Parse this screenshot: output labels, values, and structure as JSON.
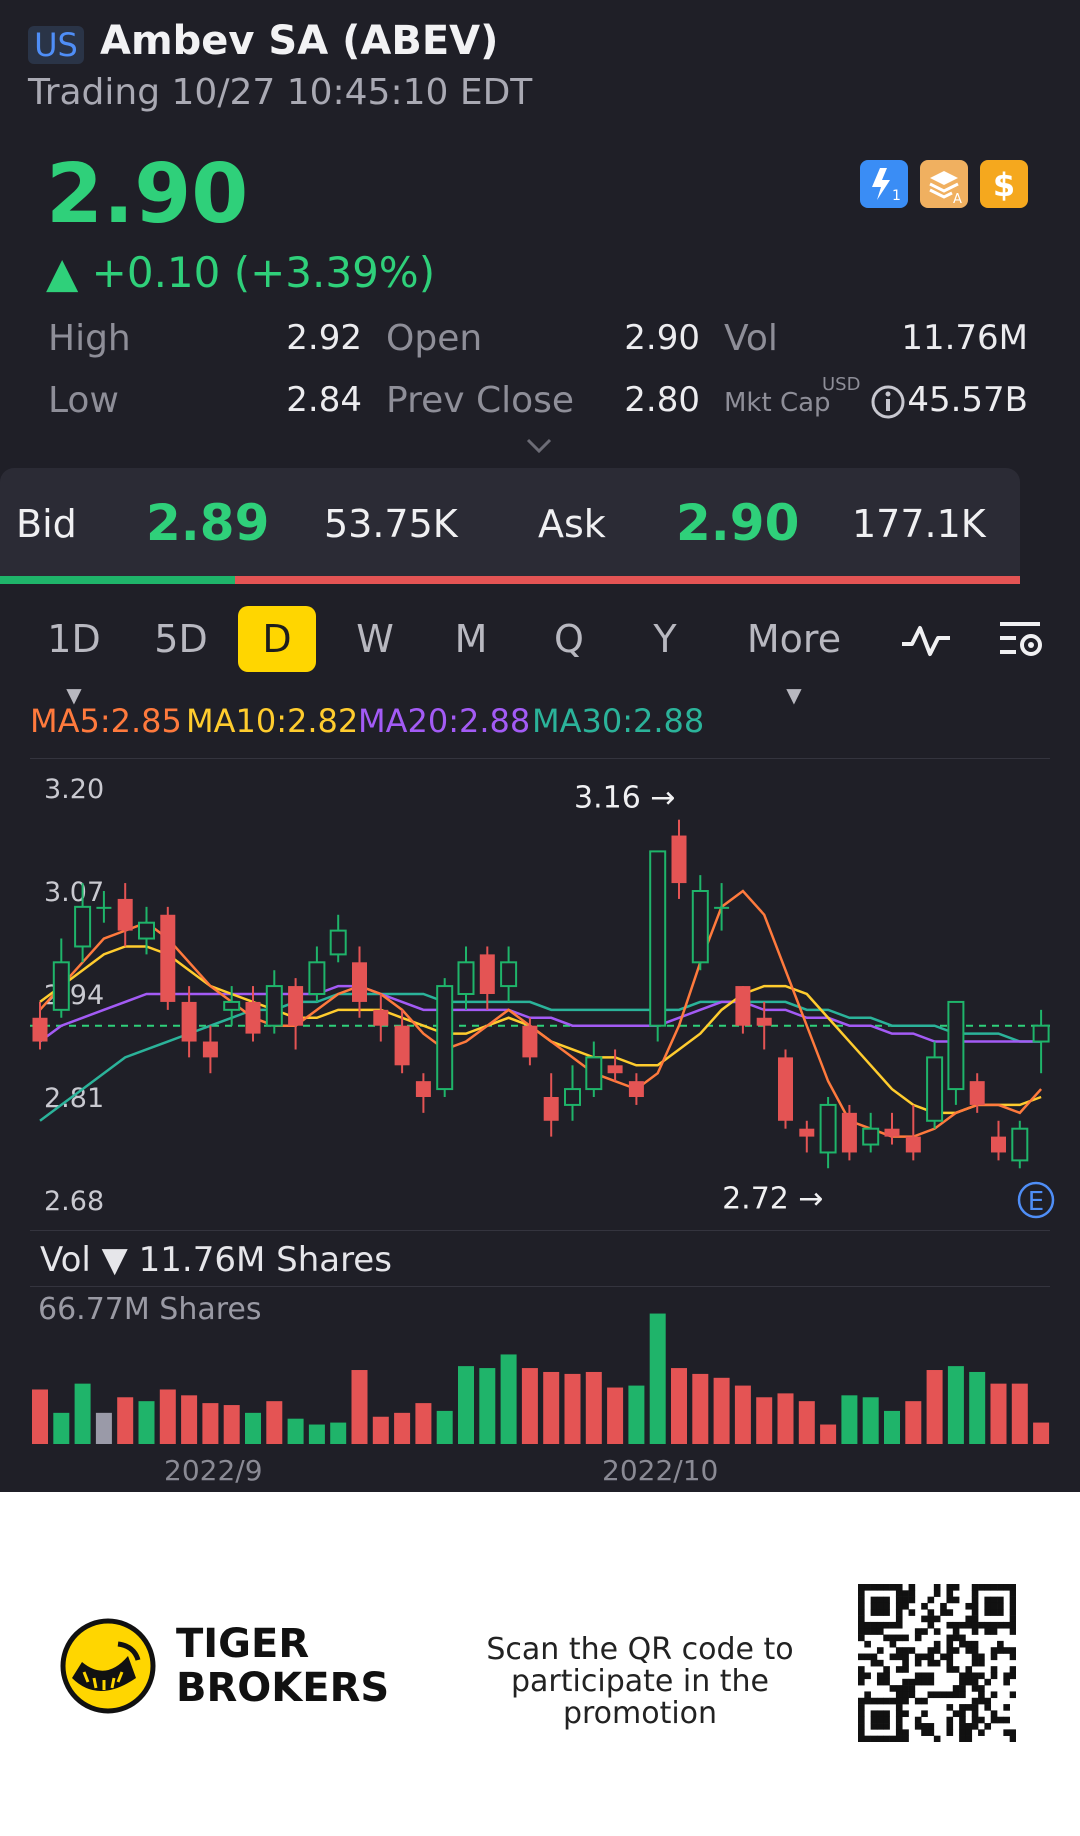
{
  "header": {
    "market": "US",
    "title": "Ambev SA (ABEV)",
    "status": "Trading 10/27 10:45:10 EDT",
    "price": "2.90",
    "change": "▲ +0.10 (+3.39%)",
    "icons": [
      "lightning-level1-icon",
      "level-a-stack-icon",
      "dollar-icon"
    ]
  },
  "stats": {
    "high_label": "High",
    "high": "2.92",
    "open_label": "Open",
    "open": "2.90",
    "vol_label": "Vol",
    "vol": "11.76M",
    "low_label": "Low",
    "low": "2.84",
    "prev_close_label": "Prev Close",
    "prev_close": "2.80",
    "mkt_cap_label": "Mkt Cap",
    "mkt_cap_currency": "USD",
    "mkt_cap": "45.57B"
  },
  "bidask": {
    "bid_label": "Bid",
    "bid_price": "2.89",
    "bid_size": "53.75K",
    "ask_label": "Ask",
    "ask_price": "2.90",
    "ask_size": "177.1K",
    "bid_ratio": 0.23
  },
  "tabs": {
    "items": [
      "1D",
      "5D",
      "D",
      "W",
      "M",
      "Q",
      "Y",
      "More"
    ],
    "active": "D"
  },
  "indicators": {
    "ma5": "MA5:2.85",
    "ma10": "MA10:2.82",
    "ma20": "MA20:2.88",
    "ma30": "MA30:2.88"
  },
  "volume": {
    "title": "Vol ▼ 11.76M Shares",
    "max_label": "66.77M Shares"
  },
  "chart_data": {
    "type": "candlestick",
    "ylim": [
      2.68,
      3.2
    ],
    "y_ticks": [
      "3.20",
      "3.07",
      "2.94",
      "2.81",
      "2.68"
    ],
    "x_ticks": [
      "2022/9",
      "2022/10"
    ],
    "high_marker": "3.16 →",
    "low_marker": "2.72 →",
    "last_price_line": 2.9,
    "event_marker": "E",
    "colors": {
      "up": "#1fb46a",
      "down": "#e45454",
      "ma5": "#ff7a3d",
      "ma10": "#ffcc2e",
      "ma20": "#a35bf5",
      "ma30": "#2bb39a"
    },
    "candles": [
      {
        "o": 2.91,
        "c": 2.88,
        "h": 2.93,
        "l": 2.87
      },
      {
        "o": 2.92,
        "c": 2.98,
        "h": 3.01,
        "l": 2.91
      },
      {
        "o": 3.0,
        "c": 3.05,
        "h": 3.08,
        "l": 2.98
      },
      {
        "o": 3.05,
        "c": 3.05,
        "h": 3.07,
        "l": 3.03
      },
      {
        "o": 3.06,
        "c": 3.02,
        "h": 3.08,
        "l": 3.0
      },
      {
        "o": 3.01,
        "c": 3.03,
        "h": 3.05,
        "l": 2.99
      },
      {
        "o": 3.04,
        "c": 2.93,
        "h": 3.05,
        "l": 2.92
      },
      {
        "o": 2.93,
        "c": 2.88,
        "h": 2.95,
        "l": 2.86
      },
      {
        "o": 2.88,
        "c": 2.86,
        "h": 2.9,
        "l": 2.84
      },
      {
        "o": 2.92,
        "c": 2.93,
        "h": 2.95,
        "l": 2.9
      },
      {
        "o": 2.93,
        "c": 2.89,
        "h": 2.95,
        "l": 2.88
      },
      {
        "o": 2.9,
        "c": 2.95,
        "h": 2.97,
        "l": 2.89
      },
      {
        "o": 2.95,
        "c": 2.9,
        "h": 2.96,
        "l": 2.87
      },
      {
        "o": 2.94,
        "c": 2.98,
        "h": 3.0,
        "l": 2.93
      },
      {
        "o": 2.99,
        "c": 3.02,
        "h": 3.04,
        "l": 2.98
      },
      {
        "o": 2.98,
        "c": 2.93,
        "h": 3.0,
        "l": 2.91
      },
      {
        "o": 2.92,
        "c": 2.9,
        "h": 2.94,
        "l": 2.88
      },
      {
        "o": 2.9,
        "c": 2.85,
        "h": 2.92,
        "l": 2.84
      },
      {
        "o": 2.83,
        "c": 2.81,
        "h": 2.84,
        "l": 2.79
      },
      {
        "o": 2.82,
        "c": 2.95,
        "h": 2.96,
        "l": 2.81
      },
      {
        "o": 2.94,
        "c": 2.98,
        "h": 3.0,
        "l": 2.92
      },
      {
        "o": 2.99,
        "c": 2.94,
        "h": 3.0,
        "l": 2.92
      },
      {
        "o": 2.95,
        "c": 2.98,
        "h": 3.0,
        "l": 2.93
      },
      {
        "o": 2.9,
        "c": 2.86,
        "h": 2.91,
        "l": 2.85
      },
      {
        "o": 2.81,
        "c": 2.78,
        "h": 2.84,
        "l": 2.76
      },
      {
        "o": 2.8,
        "c": 2.82,
        "h": 2.85,
        "l": 2.78
      },
      {
        "o": 2.82,
        "c": 2.86,
        "h": 2.88,
        "l": 2.81
      },
      {
        "o": 2.85,
        "c": 2.84,
        "h": 2.87,
        "l": 2.83
      },
      {
        "o": 2.83,
        "c": 2.81,
        "h": 2.84,
        "l": 2.8
      },
      {
        "o": 2.9,
        "c": 3.12,
        "h": 3.12,
        "l": 2.88
      },
      {
        "o": 3.14,
        "c": 3.08,
        "h": 3.16,
        "l": 3.06
      },
      {
        "o": 2.98,
        "c": 3.07,
        "h": 3.09,
        "l": 2.97
      },
      {
        "o": 3.05,
        "c": 3.05,
        "h": 3.08,
        "l": 3.02
      },
      {
        "o": 2.95,
        "c": 2.9,
        "h": 2.95,
        "l": 2.89
      },
      {
        "o": 2.91,
        "c": 2.9,
        "h": 2.93,
        "l": 2.87
      },
      {
        "o": 2.86,
        "c": 2.78,
        "h": 2.87,
        "l": 2.77
      },
      {
        "o": 2.77,
        "c": 2.76,
        "h": 2.78,
        "l": 2.74
      },
      {
        "o": 2.74,
        "c": 2.8,
        "h": 2.81,
        "l": 2.72
      },
      {
        "o": 2.79,
        "c": 2.74,
        "h": 2.8,
        "l": 2.73
      },
      {
        "o": 2.75,
        "c": 2.77,
        "h": 2.79,
        "l": 2.74
      },
      {
        "o": 2.77,
        "c": 2.76,
        "h": 2.79,
        "l": 2.75
      },
      {
        "o": 2.76,
        "c": 2.74,
        "h": 2.8,
        "l": 2.73
      },
      {
        "o": 2.78,
        "c": 2.86,
        "h": 2.88,
        "l": 2.77
      },
      {
        "o": 2.82,
        "c": 2.93,
        "h": 2.93,
        "l": 2.8
      },
      {
        "o": 2.83,
        "c": 2.8,
        "h": 2.84,
        "l": 2.79
      },
      {
        "o": 2.76,
        "c": 2.74,
        "h": 2.78,
        "l": 2.73
      },
      {
        "o": 2.73,
        "c": 2.77,
        "h": 2.78,
        "l": 2.72
      },
      {
        "o": 2.88,
        "c": 2.9,
        "h": 2.92,
        "l": 2.84
      }
    ],
    "ma5": [
      2.92,
      2.95,
      2.98,
      3.01,
      3.02,
      3.03,
      3.01,
      2.98,
      2.95,
      2.93,
      2.91,
      2.9,
      2.9,
      2.92,
      2.94,
      2.95,
      2.94,
      2.92,
      2.89,
      2.87,
      2.88,
      2.9,
      2.92,
      2.9,
      2.88,
      2.86,
      2.84,
      2.83,
      2.82,
      2.84,
      2.9,
      2.98,
      3.05,
      3.07,
      3.04,
      2.97,
      2.9,
      2.83,
      2.78,
      2.77,
      2.76,
      2.76,
      2.77,
      2.79,
      2.8,
      2.8,
      2.79,
      2.82
    ],
    "ma10": [
      2.93,
      2.95,
      2.97,
      2.99,
      3.0,
      3.0,
      2.99,
      2.97,
      2.95,
      2.94,
      2.93,
      2.92,
      2.91,
      2.91,
      2.92,
      2.92,
      2.92,
      2.91,
      2.9,
      2.89,
      2.89,
      2.9,
      2.91,
      2.9,
      2.88,
      2.87,
      2.86,
      2.86,
      2.85,
      2.85,
      2.87,
      2.89,
      2.92,
      2.94,
      2.95,
      2.95,
      2.94,
      2.91,
      2.88,
      2.85,
      2.82,
      2.8,
      2.79,
      2.79,
      2.8,
      2.8,
      2.8,
      2.81
    ],
    "ma20": [
      2.88,
      2.9,
      2.91,
      2.92,
      2.93,
      2.94,
      2.94,
      2.94,
      2.94,
      2.94,
      2.94,
      2.94,
      2.94,
      2.94,
      2.95,
      2.95,
      2.94,
      2.93,
      2.92,
      2.92,
      2.92,
      2.92,
      2.92,
      2.91,
      2.91,
      2.9,
      2.9,
      2.9,
      2.9,
      2.9,
      2.91,
      2.92,
      2.93,
      2.93,
      2.92,
      2.92,
      2.91,
      2.91,
      2.9,
      2.9,
      2.89,
      2.89,
      2.88,
      2.88,
      2.88,
      2.88,
      2.88,
      2.88
    ],
    "ma30": [
      2.78,
      2.8,
      2.82,
      2.84,
      2.86,
      2.87,
      2.88,
      2.89,
      2.9,
      2.91,
      2.92,
      2.92,
      2.93,
      2.93,
      2.94,
      2.94,
      2.94,
      2.94,
      2.94,
      2.93,
      2.93,
      2.93,
      2.93,
      2.93,
      2.92,
      2.92,
      2.92,
      2.92,
      2.92,
      2.92,
      2.92,
      2.93,
      2.93,
      2.93,
      2.93,
      2.93,
      2.92,
      2.92,
      2.91,
      2.91,
      2.9,
      2.9,
      2.9,
      2.89,
      2.89,
      2.89,
      2.88,
      2.88
    ],
    "volume_max_m": 66.77,
    "volumes_m": [
      28,
      16,
      31,
      16,
      24,
      22,
      28,
      25,
      21,
      20,
      16,
      22,
      13,
      10,
      11,
      38,
      14,
      16,
      21,
      17,
      40,
      39,
      46,
      39,
      37,
      36,
      37,
      29,
      30,
      67,
      39,
      36,
      34,
      30,
      24,
      26,
      22,
      10,
      25,
      24,
      17,
      22,
      38,
      40,
      37,
      31,
      31,
      11
    ],
    "volume_up": [
      false,
      true,
      true,
      null,
      false,
      true,
      false,
      false,
      false,
      false,
      true,
      false,
      true,
      true,
      true,
      false,
      false,
      false,
      false,
      true,
      true,
      true,
      true,
      false,
      false,
      false,
      false,
      false,
      true,
      true,
      false,
      false,
      false,
      false,
      false,
      false,
      false,
      false,
      true,
      true,
      true,
      false,
      false,
      true,
      true,
      false,
      false,
      false
    ]
  },
  "footer": {
    "brand_line1": "TIGER",
    "brand_line2": "BROKERS",
    "promo": "Scan the QR code to participate in the promotion"
  }
}
